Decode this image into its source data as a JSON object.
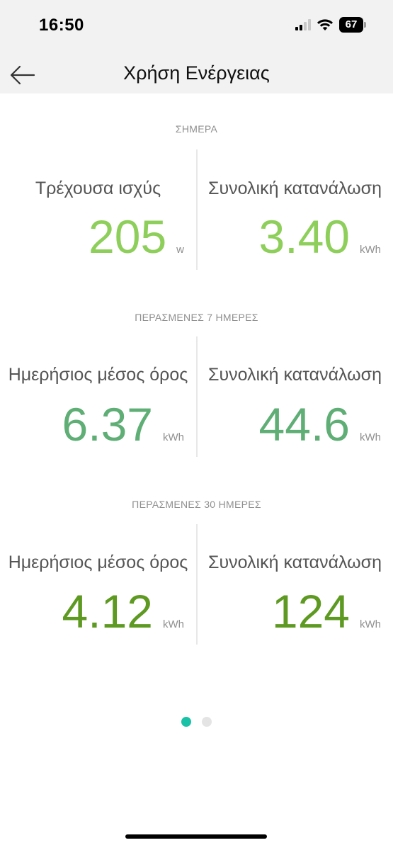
{
  "status_bar": {
    "time": "16:50",
    "battery": "67",
    "icons": [
      "cellular-signal-icon",
      "wifi-icon",
      "battery-icon"
    ]
  },
  "nav": {
    "title": "Χρήση Ενέργειας",
    "back_icon": "arrow-left-icon"
  },
  "colors": {
    "today": "#8dcf5a",
    "week": "#5fae75",
    "month": "#5e9a22",
    "dot_active": "#19c1a6",
    "dot_inactive": "#e4e4e4"
  },
  "sections": {
    "today": {
      "label": "ΣΗΜΕΡΑ",
      "left": {
        "label": "Τρέχουσα ισχύς",
        "value": "205",
        "unit": "w"
      },
      "right": {
        "label": "Συνολική κατανάλωση",
        "value": "3.40",
        "unit": "kWh"
      }
    },
    "week": {
      "label": "ΠΕΡΑΣΜΕΝΕΣ 7 ΗΜΕΡΕΣ",
      "left": {
        "label": "Ημερήσιος μέσος όρος",
        "value": "6.37",
        "unit": "kWh"
      },
      "right": {
        "label": "Συνολική κατανάλωση",
        "value": "44.6",
        "unit": "kWh"
      }
    },
    "month": {
      "label": "ΠΕΡΑΣΜΕΝΕΣ 30 ΗΜΕΡΕΣ",
      "left": {
        "label": "Ημερήσιος μέσος όρος",
        "value": "4.12",
        "unit": "kWh"
      },
      "right": {
        "label": "Συνολική κατανάλωση",
        "value": "124",
        "unit": "kWh"
      }
    }
  },
  "pager": {
    "pages": 2,
    "active": 1
  }
}
